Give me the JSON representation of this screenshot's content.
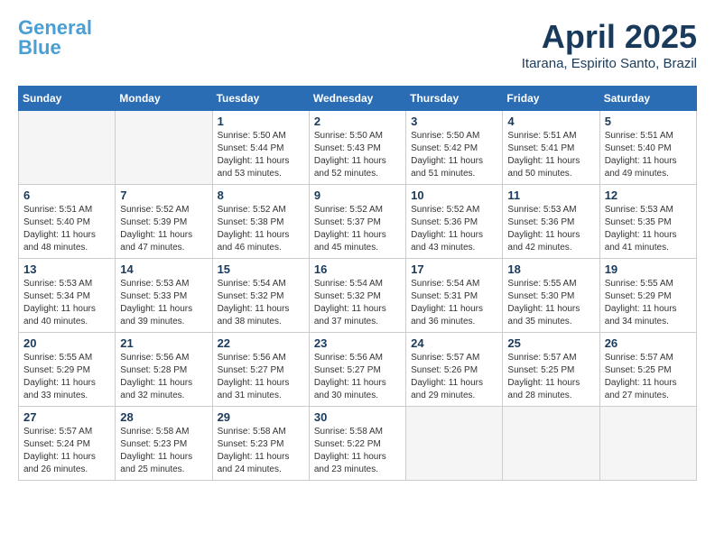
{
  "header": {
    "logo_general": "General",
    "logo_blue": "Blue",
    "month": "April 2025",
    "location": "Itarana, Espirito Santo, Brazil"
  },
  "weekdays": [
    "Sunday",
    "Monday",
    "Tuesday",
    "Wednesday",
    "Thursday",
    "Friday",
    "Saturday"
  ],
  "weeks": [
    [
      {
        "day": "",
        "info": ""
      },
      {
        "day": "",
        "info": ""
      },
      {
        "day": "1",
        "info": "Sunrise: 5:50 AM\nSunset: 5:44 PM\nDaylight: 11 hours and 53 minutes."
      },
      {
        "day": "2",
        "info": "Sunrise: 5:50 AM\nSunset: 5:43 PM\nDaylight: 11 hours and 52 minutes."
      },
      {
        "day": "3",
        "info": "Sunrise: 5:50 AM\nSunset: 5:42 PM\nDaylight: 11 hours and 51 minutes."
      },
      {
        "day": "4",
        "info": "Sunrise: 5:51 AM\nSunset: 5:41 PM\nDaylight: 11 hours and 50 minutes."
      },
      {
        "day": "5",
        "info": "Sunrise: 5:51 AM\nSunset: 5:40 PM\nDaylight: 11 hours and 49 minutes."
      }
    ],
    [
      {
        "day": "6",
        "info": "Sunrise: 5:51 AM\nSunset: 5:40 PM\nDaylight: 11 hours and 48 minutes."
      },
      {
        "day": "7",
        "info": "Sunrise: 5:52 AM\nSunset: 5:39 PM\nDaylight: 11 hours and 47 minutes."
      },
      {
        "day": "8",
        "info": "Sunrise: 5:52 AM\nSunset: 5:38 PM\nDaylight: 11 hours and 46 minutes."
      },
      {
        "day": "9",
        "info": "Sunrise: 5:52 AM\nSunset: 5:37 PM\nDaylight: 11 hours and 45 minutes."
      },
      {
        "day": "10",
        "info": "Sunrise: 5:52 AM\nSunset: 5:36 PM\nDaylight: 11 hours and 43 minutes."
      },
      {
        "day": "11",
        "info": "Sunrise: 5:53 AM\nSunset: 5:36 PM\nDaylight: 11 hours and 42 minutes."
      },
      {
        "day": "12",
        "info": "Sunrise: 5:53 AM\nSunset: 5:35 PM\nDaylight: 11 hours and 41 minutes."
      }
    ],
    [
      {
        "day": "13",
        "info": "Sunrise: 5:53 AM\nSunset: 5:34 PM\nDaylight: 11 hours and 40 minutes."
      },
      {
        "day": "14",
        "info": "Sunrise: 5:53 AM\nSunset: 5:33 PM\nDaylight: 11 hours and 39 minutes."
      },
      {
        "day": "15",
        "info": "Sunrise: 5:54 AM\nSunset: 5:32 PM\nDaylight: 11 hours and 38 minutes."
      },
      {
        "day": "16",
        "info": "Sunrise: 5:54 AM\nSunset: 5:32 PM\nDaylight: 11 hours and 37 minutes."
      },
      {
        "day": "17",
        "info": "Sunrise: 5:54 AM\nSunset: 5:31 PM\nDaylight: 11 hours and 36 minutes."
      },
      {
        "day": "18",
        "info": "Sunrise: 5:55 AM\nSunset: 5:30 PM\nDaylight: 11 hours and 35 minutes."
      },
      {
        "day": "19",
        "info": "Sunrise: 5:55 AM\nSunset: 5:29 PM\nDaylight: 11 hours and 34 minutes."
      }
    ],
    [
      {
        "day": "20",
        "info": "Sunrise: 5:55 AM\nSunset: 5:29 PM\nDaylight: 11 hours and 33 minutes."
      },
      {
        "day": "21",
        "info": "Sunrise: 5:56 AM\nSunset: 5:28 PM\nDaylight: 11 hours and 32 minutes."
      },
      {
        "day": "22",
        "info": "Sunrise: 5:56 AM\nSunset: 5:27 PM\nDaylight: 11 hours and 31 minutes."
      },
      {
        "day": "23",
        "info": "Sunrise: 5:56 AM\nSunset: 5:27 PM\nDaylight: 11 hours and 30 minutes."
      },
      {
        "day": "24",
        "info": "Sunrise: 5:57 AM\nSunset: 5:26 PM\nDaylight: 11 hours and 29 minutes."
      },
      {
        "day": "25",
        "info": "Sunrise: 5:57 AM\nSunset: 5:25 PM\nDaylight: 11 hours and 28 minutes."
      },
      {
        "day": "26",
        "info": "Sunrise: 5:57 AM\nSunset: 5:25 PM\nDaylight: 11 hours and 27 minutes."
      }
    ],
    [
      {
        "day": "27",
        "info": "Sunrise: 5:57 AM\nSunset: 5:24 PM\nDaylight: 11 hours and 26 minutes."
      },
      {
        "day": "28",
        "info": "Sunrise: 5:58 AM\nSunset: 5:23 PM\nDaylight: 11 hours and 25 minutes."
      },
      {
        "day": "29",
        "info": "Sunrise: 5:58 AM\nSunset: 5:23 PM\nDaylight: 11 hours and 24 minutes."
      },
      {
        "day": "30",
        "info": "Sunrise: 5:58 AM\nSunset: 5:22 PM\nDaylight: 11 hours and 23 minutes."
      },
      {
        "day": "",
        "info": ""
      },
      {
        "day": "",
        "info": ""
      },
      {
        "day": "",
        "info": ""
      }
    ]
  ]
}
